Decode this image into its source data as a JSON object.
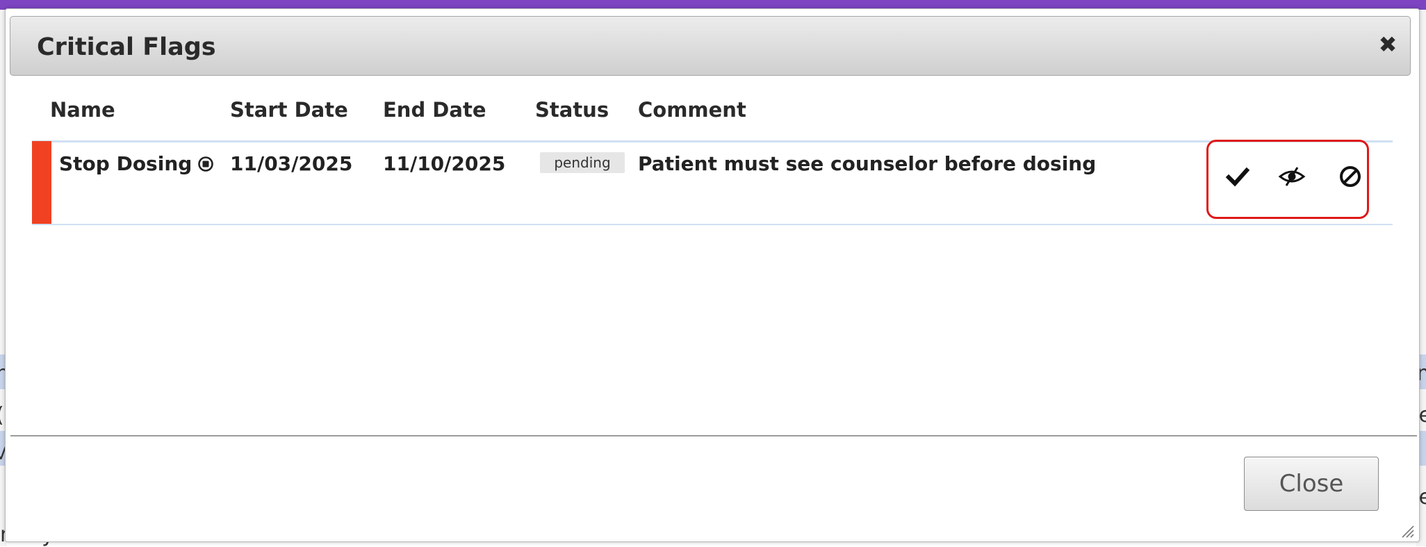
{
  "dialog": {
    "title": "Critical Flags",
    "close_icon": "close-icon",
    "footer_close_label": "Close"
  },
  "table": {
    "columns": [
      "Name",
      "Start Date",
      "End Date",
      "Status",
      "Comment"
    ],
    "rows": [
      {
        "name": "Stop Dosing",
        "name_icon": "stop-circle-icon",
        "start_date": "11/03/2025",
        "end_date": "11/10/2025",
        "status": "pending",
        "comment": "Patient must see counselor before dosing",
        "flag_color": "#f04123",
        "actions": [
          "checkmark-icon",
          "eye-slash-icon",
          "ban-icon"
        ]
      }
    ]
  },
  "background": {
    "fragments_right": [
      "m",
      "e",
      "e"
    ],
    "fragments_left": [
      "n",
      "(",
      "M",
      "l",
      "mary"
    ],
    "accent_color": "#7d45c2"
  },
  "colors": {
    "highlight_border": "#e01818",
    "row_divider": "#cfe0f2"
  }
}
